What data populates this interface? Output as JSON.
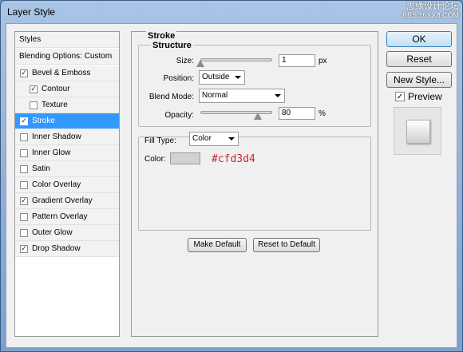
{
  "window": {
    "title": "Layer Style"
  },
  "watermark": {
    "top": "思缘设计论坛",
    "bottom": "BBS.16XX8.COM"
  },
  "styles_panel": {
    "header": "Styles",
    "blending": "Blending Options: Custom",
    "items": [
      {
        "label": "Bevel & Emboss",
        "checked": true
      },
      {
        "label": "Contour",
        "checked": true,
        "indent": true
      },
      {
        "label": "Texture",
        "checked": false,
        "indent": true
      },
      {
        "label": "Stroke",
        "checked": true,
        "selected": true
      },
      {
        "label": "Inner Shadow",
        "checked": false
      },
      {
        "label": "Inner Glow",
        "checked": false
      },
      {
        "label": "Satin",
        "checked": false
      },
      {
        "label": "Color Overlay",
        "checked": false
      },
      {
        "label": "Gradient Overlay",
        "checked": true
      },
      {
        "label": "Pattern Overlay",
        "checked": false
      },
      {
        "label": "Outer Glow",
        "checked": false
      },
      {
        "label": "Drop Shadow",
        "checked": true
      }
    ]
  },
  "stroke": {
    "group_title": "Stroke",
    "structure_title": "Structure",
    "size_label": "Size:",
    "size_value": "1",
    "size_unit": "px",
    "size_fraction": 0.0,
    "position_label": "Position:",
    "position_value": "Outside",
    "blend_label": "Blend Mode:",
    "blend_value": "Normal",
    "opacity_label": "Opacity:",
    "opacity_value": "80",
    "opacity_unit": "%",
    "opacity_fraction": 0.8,
    "fill_type_label": "Fill Type:",
    "fill_type_value": "Color",
    "color_label": "Color:",
    "color_hex": "#cfd3d4",
    "color_note": "#cfd3d4",
    "make_default": "Make Default",
    "reset_default": "Reset to Default"
  },
  "actions": {
    "ok": "OK",
    "reset": "Reset",
    "new_style": "New Style...",
    "preview_label": "Preview",
    "preview_checked": true
  }
}
